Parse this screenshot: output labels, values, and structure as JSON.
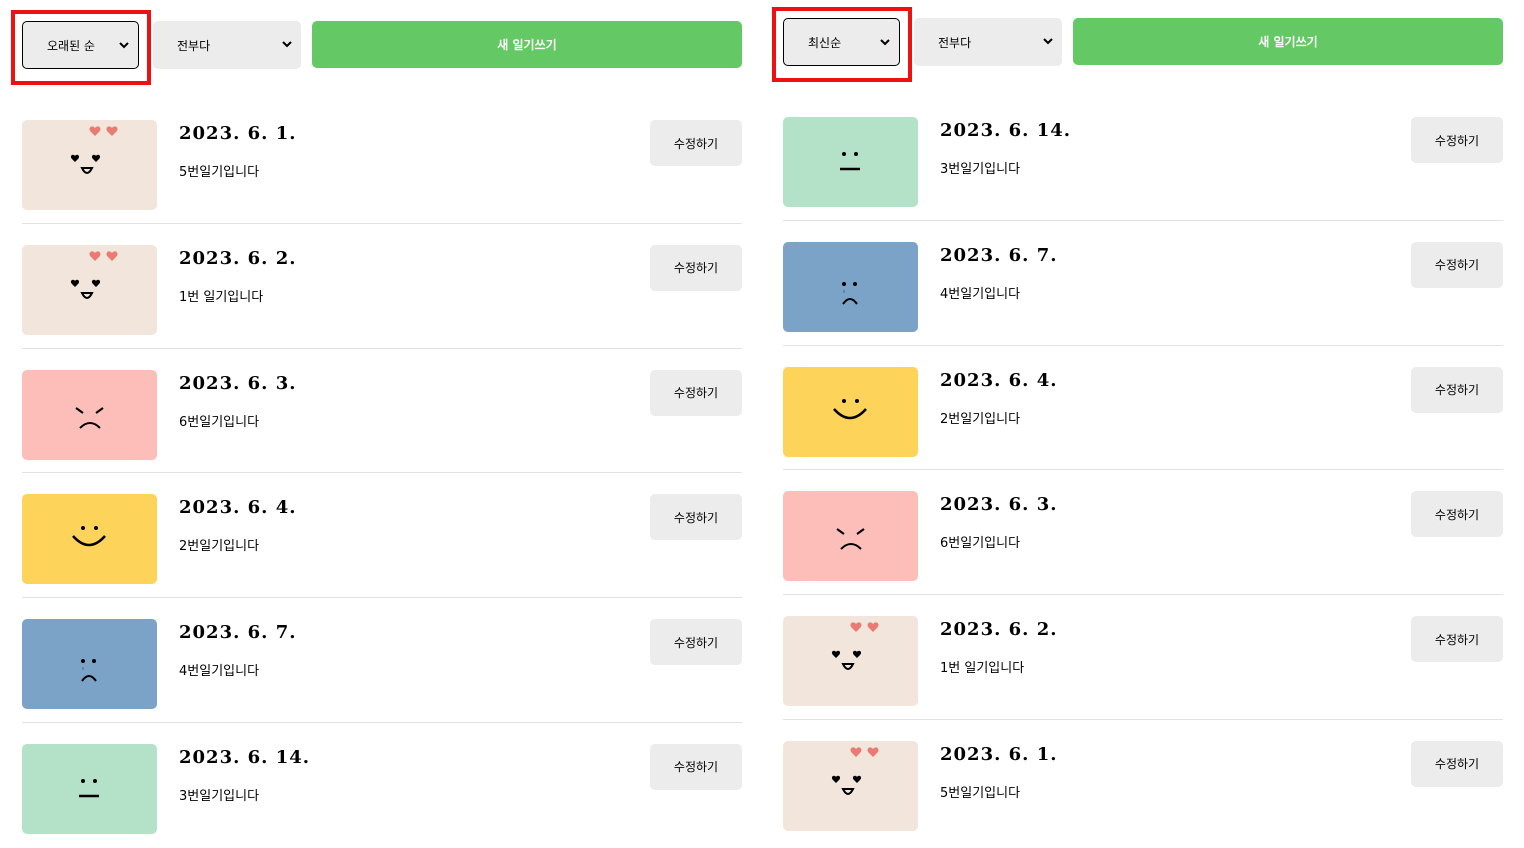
{
  "left_panel": {
    "menu": {
      "sort_value": "오래된 순",
      "filter_value": "전부다",
      "new_button_label": "새 일기쓰기"
    },
    "items": [
      {
        "date": "2023. 6. 1.",
        "content": "5번일기입니다",
        "edit_label": "수정하기",
        "emotion": "love",
        "color": "#f1e5dc"
      },
      {
        "date": "2023. 6. 2.",
        "content": "1번 일기입니다",
        "edit_label": "수정하기",
        "emotion": "love",
        "color": "#f1e5dc"
      },
      {
        "date": "2023. 6. 3.",
        "content": "6번일기입니다",
        "edit_label": "수정하기",
        "emotion": "angry",
        "color": "#fdbdb9"
      },
      {
        "date": "2023. 6. 4.",
        "content": "2번일기입니다",
        "edit_label": "수정하기",
        "emotion": "happy",
        "color": "#fdd35a"
      },
      {
        "date": "2023. 6. 7.",
        "content": "4번일기입니다",
        "edit_label": "수정하기",
        "emotion": "sad",
        "color": "#7ba3c7"
      },
      {
        "date": "2023. 6. 14.",
        "content": "3번일기입니다",
        "edit_label": "수정하기",
        "emotion": "neutral",
        "color": "#b3e2c8"
      }
    ]
  },
  "right_panel": {
    "menu": {
      "sort_value": "최신순",
      "filter_value": "전부다",
      "new_button_label": "새 일기쓰기"
    },
    "items": [
      {
        "date": "2023. 6. 14.",
        "content": "3번일기입니다",
        "edit_label": "수정하기",
        "emotion": "neutral",
        "color": "#b3e2c8"
      },
      {
        "date": "2023. 6. 7.",
        "content": "4번일기입니다",
        "edit_label": "수정하기",
        "emotion": "sad",
        "color": "#7ba3c7"
      },
      {
        "date": "2023. 6. 4.",
        "content": "2번일기입니다",
        "edit_label": "수정하기",
        "emotion": "happy",
        "color": "#fdd35a"
      },
      {
        "date": "2023. 6. 3.",
        "content": "6번일기입니다",
        "edit_label": "수정하기",
        "emotion": "angry",
        "color": "#fdbdb9"
      },
      {
        "date": "2023. 6. 2.",
        "content": "1번 일기입니다",
        "edit_label": "수정하기",
        "emotion": "love",
        "color": "#f1e5dc"
      },
      {
        "date": "2023. 6. 1.",
        "content": "5번일기입니다",
        "edit_label": "수정하기",
        "emotion": "love",
        "color": "#f1e5dc"
      }
    ]
  },
  "colors": {
    "new_button": "#64c964",
    "select_bg": "#ececec",
    "highlight_border": "#ee1111"
  }
}
